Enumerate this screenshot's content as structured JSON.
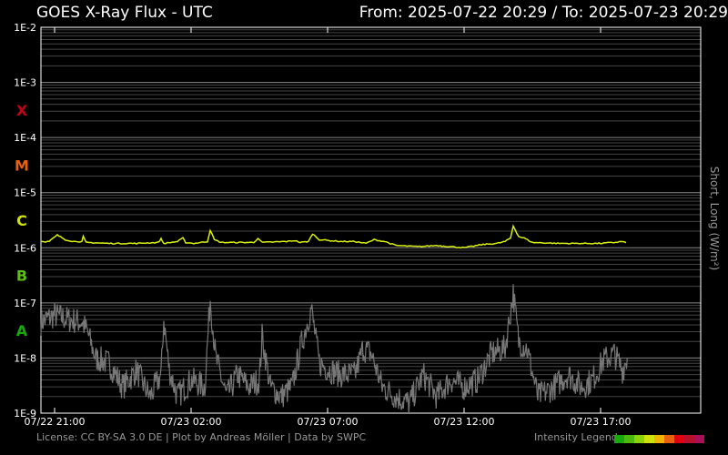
{
  "header": {
    "title": "GOES X-Ray Flux - UTC",
    "range": "From: 2025-07-22 20:29  /  To: 2025-07-23 20:29"
  },
  "footer": {
    "license": "License: CC BY-SA 3.0 DE | Plot by Andreas Möller | Data by SWPC",
    "legend_label": "Intensity Legend"
  },
  "legend_colors": [
    "#1aa80f",
    "#4cba0c",
    "#8cd20a",
    "#d0e00a",
    "#f0b400",
    "#e86010",
    "#e00010",
    "#b8102a",
    "#a8105a"
  ],
  "chart_data": {
    "type": "line",
    "title": "GOES X-Ray Flux - UTC",
    "ylabel": "Short, Long (W/m²)",
    "yscale": "log",
    "ylim": [
      1e-09,
      0.01
    ],
    "xlim_hours_from_start": [
      0,
      24
    ],
    "yticks": [
      "1E-2",
      "1E-3",
      "1E-4",
      "1E-5",
      "1E-6",
      "1E-7",
      "1E-8",
      "1E-9"
    ],
    "xticks": [
      {
        "label": "07/22 21:00",
        "h": 0.5
      },
      {
        "label": "07/23 02:00",
        "h": 5.5
      },
      {
        "label": "07/23 07:00",
        "h": 10.5
      },
      {
        "label": "07/23 12:00",
        "h": 15.5
      },
      {
        "label": "07/23 17:00",
        "h": 20.5
      }
    ],
    "classes": [
      {
        "label": "X",
        "color": "#c0001a",
        "decade": -4
      },
      {
        "label": "M",
        "color": "#e8600c",
        "decade": -5
      },
      {
        "label": "C",
        "color": "#d0e00a",
        "decade": -6
      },
      {
        "label": "B",
        "color": "#5cc010",
        "decade": -7
      },
      {
        "label": "A",
        "color": "#1aa80f",
        "decade": -8
      }
    ],
    "series": [
      {
        "name": "Long",
        "color": "#d8f010",
        "points": [
          [
            0,
            1.3e-06
          ],
          [
            0.3,
            1.3e-06
          ],
          [
            0.6,
            1.7e-06
          ],
          [
            0.9,
            1.4e-06
          ],
          [
            1.2,
            1.3e-06
          ],
          [
            1.5,
            1.3e-06
          ],
          [
            1.55,
            1.6e-06
          ],
          [
            1.65,
            1.25e-06
          ],
          [
            2.5,
            1.2e-06
          ],
          [
            3.5,
            1.2e-06
          ],
          [
            4.3,
            1.25e-06
          ],
          [
            4.4,
            1.45e-06
          ],
          [
            4.5,
            1.2e-06
          ],
          [
            5,
            1.3e-06
          ],
          [
            5.2,
            1.5e-06
          ],
          [
            5.3,
            1.25e-06
          ],
          [
            5.6,
            1.2e-06
          ],
          [
            6.1,
            1.3e-06
          ],
          [
            6.2,
            2.1e-06
          ],
          [
            6.35,
            1.4e-06
          ],
          [
            6.6,
            1.25e-06
          ],
          [
            7.8,
            1.25e-06
          ],
          [
            7.95,
            1.5e-06
          ],
          [
            8.1,
            1.25e-06
          ],
          [
            9,
            1.3e-06
          ],
          [
            9.3,
            1.35e-06
          ],
          [
            9.5,
            1.25e-06
          ],
          [
            9.8,
            1.3e-06
          ],
          [
            9.95,
            1.8e-06
          ],
          [
            10.2,
            1.4e-06
          ],
          [
            11,
            1.3e-06
          ],
          [
            11.5,
            1.3e-06
          ],
          [
            11.9,
            1.2e-06
          ],
          [
            12.2,
            1.4e-06
          ],
          [
            12.6,
            1.3e-06
          ],
          [
            13,
            1.1e-06
          ],
          [
            13.8,
            1.05e-06
          ],
          [
            14.5,
            1.1e-06
          ],
          [
            15,
            1.05e-06
          ],
          [
            15.5,
            1e-06
          ],
          [
            16.2,
            1.15e-06
          ],
          [
            16.7,
            1.2e-06
          ],
          [
            17,
            1.3e-06
          ],
          [
            17.2,
            1.5e-06
          ],
          [
            17.3,
            2.5e-06
          ],
          [
            17.5,
            1.6e-06
          ],
          [
            17.7,
            1.5e-06
          ],
          [
            18,
            1.25e-06
          ],
          [
            19,
            1.2e-06
          ],
          [
            20,
            1.2e-06
          ],
          [
            20.5,
            1.2e-06
          ],
          [
            21,
            1.25e-06
          ],
          [
            21.3,
            1.3e-06
          ],
          [
            21.5,
            1.2e-06
          ]
        ]
      },
      {
        "name": "Short",
        "color": "#777777",
        "points": [
          [
            0,
            4.5e-08
          ],
          [
            0.5,
            6e-08
          ],
          [
            1,
            5e-08
          ],
          [
            1.5,
            4.5e-08
          ],
          [
            1.7,
            3e-08
          ],
          [
            2,
            1e-08
          ],
          [
            2.5,
            8e-09
          ],
          [
            3,
            3e-09
          ],
          [
            3.5,
            6e-09
          ],
          [
            3.8,
            3e-09
          ],
          [
            4,
            2e-09
          ],
          [
            4.4,
            5e-09
          ],
          [
            4.5,
            5e-08
          ],
          [
            4.7,
            6e-09
          ],
          [
            5,
            2e-09
          ],
          [
            5.5,
            4e-09
          ],
          [
            6,
            3e-09
          ],
          [
            6.2,
            1.2e-07
          ],
          [
            6.4,
            1e-08
          ],
          [
            6.8,
            2e-09
          ],
          [
            7.2,
            5e-09
          ],
          [
            7.6,
            3e-09
          ],
          [
            8,
            4e-09
          ],
          [
            8.1,
            2.5e-08
          ],
          [
            8.4,
            3e-09
          ],
          [
            8.8,
            2e-09
          ],
          [
            9.2,
            3e-09
          ],
          [
            9.5,
            1.5e-08
          ],
          [
            9.9,
            8e-08
          ],
          [
            10.2,
            8e-09
          ],
          [
            10.6,
            6e-09
          ],
          [
            11,
            5e-09
          ],
          [
            11.5,
            5e-09
          ],
          [
            11.8,
            1.5e-08
          ],
          [
            12.1,
            1.2e-08
          ],
          [
            12.5,
            3e-09
          ],
          [
            13,
            2e-09
          ],
          [
            13.5,
            1.5e-09
          ],
          [
            14,
            5e-09
          ],
          [
            14.5,
            2e-09
          ],
          [
            15,
            4e-09
          ],
          [
            15.5,
            3e-09
          ],
          [
            16,
            4e-09
          ],
          [
            16.5,
            1.2e-08
          ],
          [
            17,
            1.5e-08
          ],
          [
            17.3,
            1.5e-07
          ],
          [
            17.5,
            2e-08
          ],
          [
            17.8,
            1.5e-08
          ],
          [
            18.2,
            2e-09
          ],
          [
            18.8,
            3e-09
          ],
          [
            19.3,
            5e-09
          ],
          [
            19.8,
            3e-09
          ],
          [
            20.2,
            4e-09
          ],
          [
            20.6,
            9e-09
          ],
          [
            21,
            1.2e-08
          ],
          [
            21.3,
            6e-09
          ],
          [
            21.5,
            1.1e-08
          ]
        ]
      }
    ]
  }
}
